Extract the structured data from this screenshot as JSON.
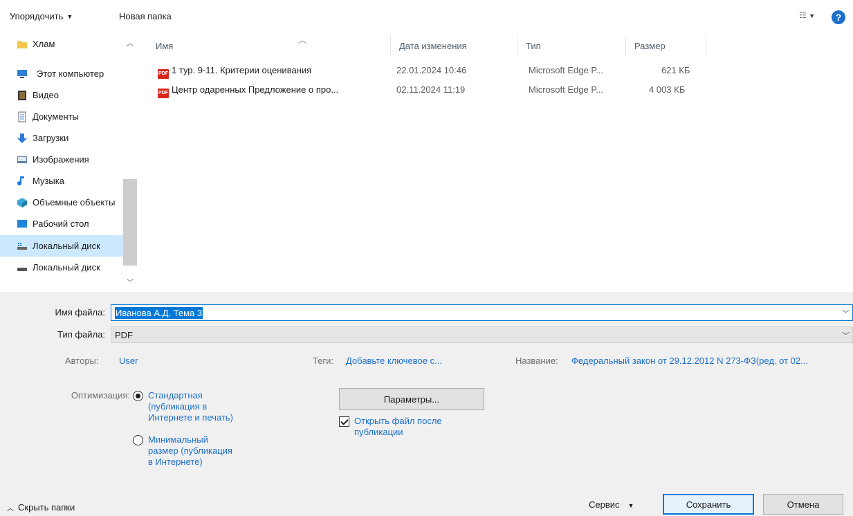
{
  "toolbar": {
    "organize_label": "Упорядочить",
    "new_folder_label": "Новая папка",
    "help_label": "?"
  },
  "nav": {
    "items": [
      {
        "label": "Хлам",
        "icon": "folder-icon"
      },
      {
        "label": "Этот компьютер",
        "icon": "computer-icon"
      },
      {
        "label": "Видео",
        "icon": "video-icon"
      },
      {
        "label": "Документы",
        "icon": "documents-icon"
      },
      {
        "label": "Загрузки",
        "icon": "downloads-icon"
      },
      {
        "label": "Изображения",
        "icon": "pictures-icon"
      },
      {
        "label": "Музыка",
        "icon": "music-icon"
      },
      {
        "label": "Объемные объекты",
        "icon": "3d-objects-icon"
      },
      {
        "label": "Рабочий стол",
        "icon": "desktop-icon"
      },
      {
        "label": "Локальный диск",
        "icon": "local-disk-icon"
      },
      {
        "label": "Локальный диск",
        "icon": "drive-icon"
      }
    ]
  },
  "files": {
    "columns": [
      "Имя",
      "Дата изменения",
      "Тип",
      "Размер"
    ],
    "rows": [
      {
        "name": "1 тур. 9-11. Критерии оценивания",
        "date": "22.01.2024 10:46",
        "type": "Microsoft Edge P...",
        "size": "621 КБ"
      },
      {
        "name": "Центр одаренных Предложение о про...",
        "date": "02.11.2024 11:19",
        "type": "Microsoft Edge P...",
        "size": "4 003 КБ"
      }
    ]
  },
  "form": {
    "filename_label": "Имя файла:",
    "filename_value": "Иванова А.Д. Тема 3",
    "filetype_label": "Тип файла:",
    "filetype_value": "PDF",
    "authors_label": "Авторы:",
    "authors_value": "User",
    "tags_label": "Теги:",
    "tags_value": "Добавьте ключевое с...",
    "title_label": "Название:",
    "title_value": "Федеральный закон от 29.12.2012 N 273-ФЗ(ред. от 02...",
    "optimize_label": "Оптимизация:",
    "opt_standard": [
      "Стандартная",
      "(публикация в",
      "Интернете и печать)"
    ],
    "opt_minimal": [
      "Минимальный",
      "размер (публикация",
      "в Интернете)"
    ],
    "params_label": "Параметры...",
    "open_after": [
      "Открыть файл после",
      "публикации"
    ]
  },
  "footer": {
    "hide_folders_label": "Скрыть папки",
    "tools_label": "Сервис",
    "save_label": "Сохранить",
    "cancel_label": "Отмена"
  },
  "colors": {
    "accent": "#0078d7",
    "link": "#1a6fcc",
    "selection": "#cce8ff"
  }
}
